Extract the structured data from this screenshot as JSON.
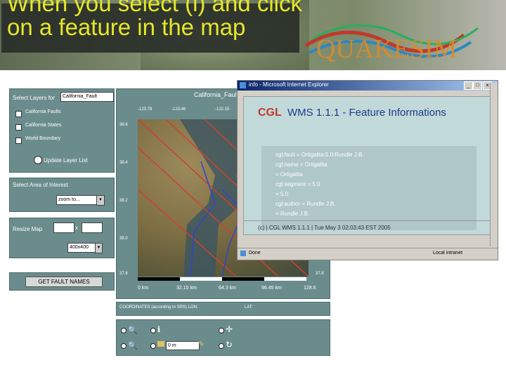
{
  "slide": {
    "title": "When you select (i) and click on a feature in the map"
  },
  "layers_panel": {
    "label": "Select Layers for",
    "selected": "California_Fault",
    "layers": [
      "California Faults",
      "California States",
      "World Boundary"
    ],
    "update_button": "Update Layer List"
  },
  "area_panel": {
    "label": "Select Area of Interest",
    "dropdown": "zoom to..."
  },
  "resize_panel": {
    "label": "Resize Map",
    "x_sep": "x",
    "size_dropdown": "400x400"
  },
  "fault_button": {
    "label": "GET FAULT NAMES"
  },
  "map": {
    "title": "California_Faults",
    "top_ticks": [
      "-123.78",
      "-123.46",
      "-122.15"
    ],
    "left_ticks": [
      "38.6",
      "38.4",
      "38.2",
      "38.0",
      "37.8"
    ],
    "scale_labels": [
      "0 km",
      "32.15 km",
      "64.3 km",
      "96.45 km",
      "128.6"
    ],
    "coords_label": "COORDINATES (according to SRS) LON:",
    "lat_label": "LAT:"
  },
  "toolbar": {
    "scale_input": "0 m"
  },
  "popup": {
    "window_title": "info - Microsoft Internet Explorer",
    "heading_prefix": "CGL",
    "heading": "WMS 1.1.1 - Feature Informations",
    "lines": [
      "cgl:fault = Ortigalita:5.0:Rundle J.B.",
      "cgl:name = Ortigalita",
      "= Ortigalita",
      "cgl:segment = 5.0",
      "= 5.0",
      "cgl:author = Rundle J.B.",
      "= Rundle J.B."
    ],
    "footer": "(c) | CGL WMS 1.1.1 | Tue May 3 02:03:43 EST 2005",
    "status_left": "Done",
    "status_right": "Local intranet"
  },
  "banner": {
    "logo_text": "QUAKESIM"
  }
}
